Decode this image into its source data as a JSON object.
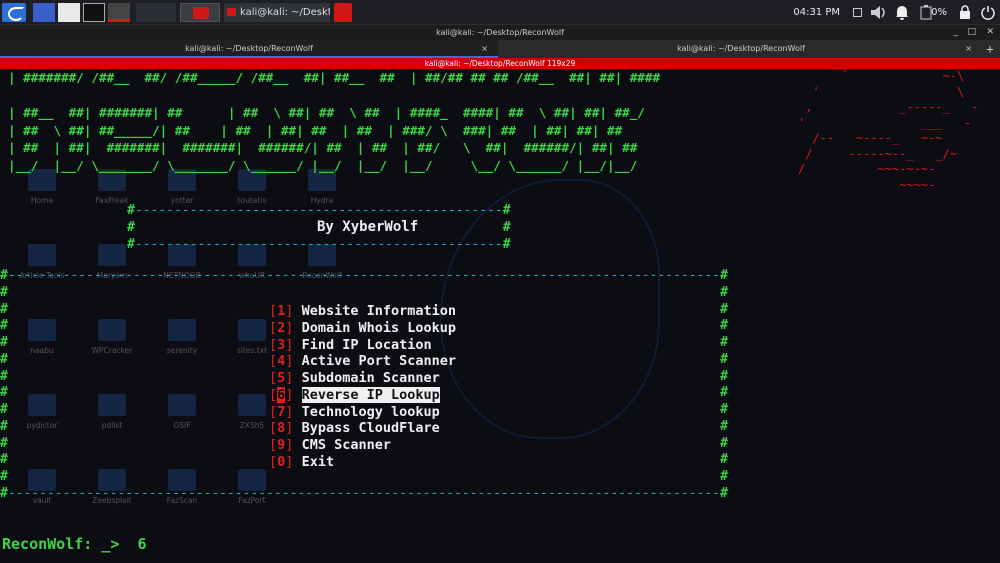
{
  "panel": {
    "clock": "04:31 PM",
    "battery": "0%"
  },
  "taskbar": {
    "terminal_task": "kali@kali: ~/Desktop/Re..."
  },
  "window": {
    "title": "kali@kali: ~/Desktop/ReconWolf",
    "controls": [
      "_",
      "□",
      "✕"
    ]
  },
  "tabs": [
    {
      "label": "kali@kali: ~/Desktop/ReconWolf",
      "close": "×"
    },
    {
      "label": "kali@kali: ~/Desktop/ReconWolf",
      "close": "×"
    }
  ],
  "tabs_new": "+",
  "terminal": {
    "title": "kali@kali: ~/Desktop/ReconWolf 119x29"
  },
  "desktop_icons": [
    "Home",
    "FaxFreak",
    "yotter",
    "toutatis",
    "Hydra",
    "Article Tools",
    "Maryam",
    "NETNOOB",
    "whoUR",
    "ReconWolf",
    "naabu",
    "WPCracker",
    "serenity",
    "sites.txt",
    "pydictor",
    "pdlist",
    "OSIF",
    "ZXSh5",
    "vault",
    "Zeebsploit",
    "FazScan",
    "FazPort"
  ],
  "banner": {
    "lines": [
      "| #######/ /##__  ##/ /##_____/ /##__  ##| ##__  ##  | ##/## ## ## /##__  ##| ##| ####",
      "",
      "| ##__  ##| #######| ##      | ##  \\ ##| ##  \\ ##  | ####_  ####| ##  \\ ##| ##| ##_/",
      "| ##  \\ ##| ##_____/| ##    | ##  | ##| ##  | ##  | ###/ \\  ###| ##  | ##| ##| ##",
      "| ##  | ##|  #######|  #######|  ######/| ##  | ##  | ##/   \\  ##|  ######/| ##| ##",
      "|__/  |__/ \\_______/ \\_______/ \\______/ |__/  |__/  |__/     \\__/ \\______/ |__/|__/"
    ]
  },
  "wolf_art": [
    "      ¯             ~-\\",
    "  '                   \\",
    " ,            _-----_   -",
    "'                ___   -",
    "  /--   ~----_   ~-~",
    " /     -----~--_   _/~",
    "/          ~~~-~-~-",
    "              ~~~~-"
  ],
  "header_box": {
    "top": "#-----------------------------------------------#",
    "mid": "#                                               #",
    "bottom": "#-----------------------------------------------#",
    "author": "By XyberWolf"
  },
  "menu_box": {
    "border": "#-------------------------------------------------------------------------------------------#",
    "side": "#"
  },
  "menu": [
    {
      "num": "1",
      "label": "Website Information"
    },
    {
      "num": "2",
      "label": "Domain Whois Lookup"
    },
    {
      "num": "3",
      "label": "Find IP Location"
    },
    {
      "num": "4",
      "label": "Active Port Scanner"
    },
    {
      "num": "5",
      "label": "Subdomain Scanner"
    },
    {
      "num": "6",
      "label": "Reverse IP Lookup",
      "selected": true
    },
    {
      "num": "7",
      "label": "Technology lookup"
    },
    {
      "num": "8",
      "label": "Bypass CloudFlare"
    },
    {
      "num": "9",
      "label": "CMS Scanner"
    },
    {
      "num": "0",
      "label": "Exit"
    }
  ],
  "prompt": {
    "text": "ReconWolf: _>",
    "input": "6"
  },
  "colors": {
    "banner_green": "#3fd447",
    "accent_red": "#e02020",
    "border_cyan": "#1fb1c4",
    "panel_bg": "#1d1f24"
  }
}
